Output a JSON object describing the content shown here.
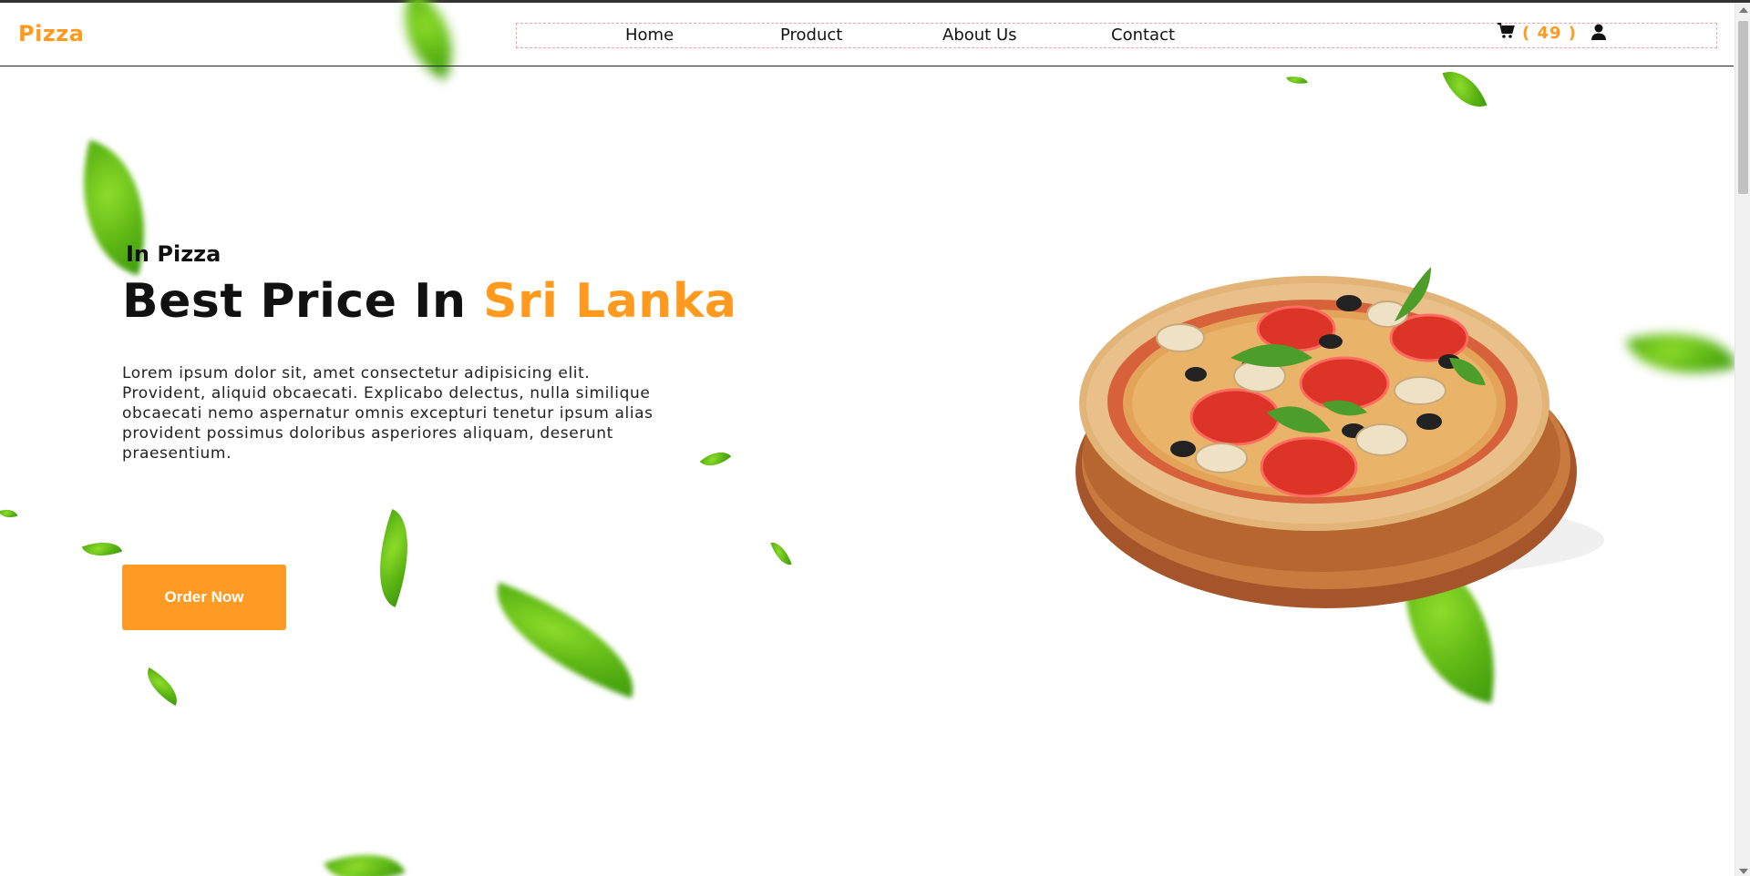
{
  "brand": {
    "logo": "Pizza",
    "accent_color": "#ff9a1f"
  },
  "nav": {
    "items": [
      {
        "label": "Home"
      },
      {
        "label": "Product"
      },
      {
        "label": "About Us"
      },
      {
        "label": "Contact"
      }
    ]
  },
  "cart": {
    "count_text": "( 49 )",
    "icon": "cart-icon"
  },
  "user": {
    "icon": "user-icon"
  },
  "hero": {
    "eyebrow": "In Pizza",
    "headline_main": "Best Price In ",
    "headline_accent": "Sri Lanka",
    "description": "Lorem ipsum dolor sit, amet consectetur adipisicing elit. Provident, aliquid obcaecati. Explicabo delectus, nulla similique obcaecati nemo aspernatur omnis excepturi tenetur ipsum alias provident possimus doloribus asperiores aliquam, deserunt praesentium.",
    "cta_label": "Order Now"
  },
  "images": {
    "hero_image": "pizza-image"
  }
}
